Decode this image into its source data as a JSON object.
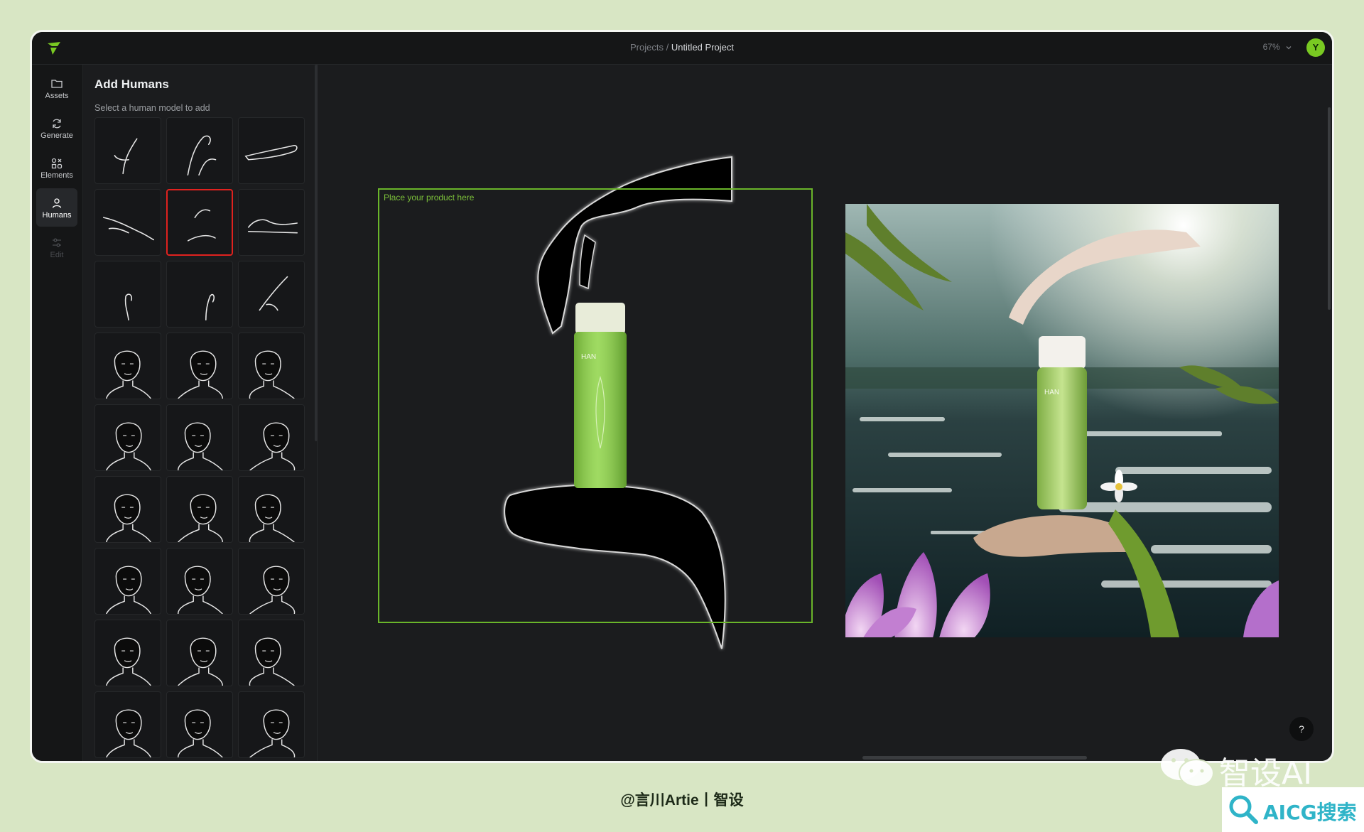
{
  "topbar": {
    "breadcrumb_parent": "Projects",
    "breadcrumb_sep": " / ",
    "breadcrumb_current": "Untitled Project",
    "zoom": "67%",
    "avatar_initial": "Y"
  },
  "rail": {
    "items": [
      {
        "label": "Assets",
        "icon": "folder-icon"
      },
      {
        "label": "Generate",
        "icon": "refresh-icon"
      },
      {
        "label": "Elements",
        "icon": "shapes-icon"
      },
      {
        "label": "Humans",
        "icon": "person-icon",
        "active": true
      },
      {
        "label": "Edit",
        "icon": "sliders-icon",
        "disabled": true
      }
    ]
  },
  "panel": {
    "title": "Add Humans",
    "subtitle": "Select a human model to add",
    "selected_index": 4,
    "tile_kinds": [
      "hand",
      "hand",
      "hand",
      "hand",
      "hand",
      "hand",
      "hand",
      "hand",
      "hand",
      "face",
      "face",
      "face",
      "face",
      "face",
      "face",
      "face",
      "face",
      "face",
      "face",
      "face",
      "face",
      "face",
      "face",
      "face",
      "face",
      "face",
      "face"
    ]
  },
  "canvas": {
    "placeholder_label": "Place your product here",
    "help_label": "?"
  },
  "colors": {
    "accent": "#79c922",
    "guide": "#6ab52a",
    "selected": "#e0221f"
  },
  "footer": {
    "credit": "@言川Artie丨智设",
    "watermark": "智设AI",
    "badge": "AICG搜索"
  }
}
